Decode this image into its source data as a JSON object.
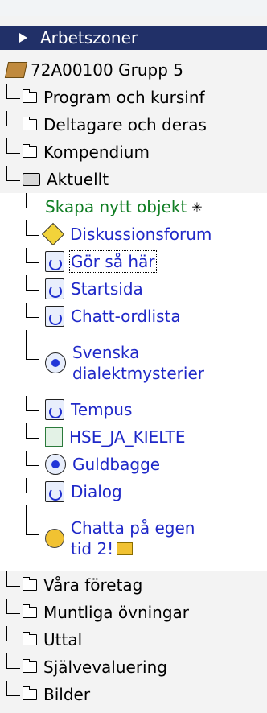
{
  "header": {
    "title": "Arbetszoner"
  },
  "course": {
    "label": "72A00100 Grupp 5"
  },
  "folders_top": [
    {
      "label": "Program och kursinf"
    },
    {
      "label": "Deltagare och deras"
    },
    {
      "label": "Kompendium"
    }
  ],
  "open_folder": {
    "label": "Aktuellt"
  },
  "items": [
    {
      "label": "Skapa nytt objekt",
      "icon": "star-icon",
      "kind": "create"
    },
    {
      "label": "Diskussionsforum",
      "icon": "forum-icon"
    },
    {
      "label": "Gör så här",
      "icon": "page-icon",
      "focused": true
    },
    {
      "label": "Startsida",
      "icon": "page-icon"
    },
    {
      "label": "Chatt-ordlista",
      "icon": "page-icon"
    },
    {
      "label_line1": "Svenska",
      "label_line2": "dialektmysterier",
      "icon": "web-link-icon"
    },
    {
      "label": "Tempus",
      "icon": "page-icon"
    },
    {
      "label": "HSE_JA_KIELTE",
      "icon": "document-icon"
    },
    {
      "label": "Guldbagge",
      "icon": "web-link-icon"
    },
    {
      "label": "Dialog",
      "icon": "page-icon"
    },
    {
      "label_line1": "Chatta på egen",
      "label_line2": "tid 2!",
      "icon": "chat-icon"
    }
  ],
  "folders_bottom": [
    {
      "label": "Våra företag"
    },
    {
      "label": "Muntliga övningar"
    },
    {
      "label": "Uttal"
    },
    {
      "label": "Självevaluering"
    },
    {
      "label": "Bilder"
    }
  ]
}
